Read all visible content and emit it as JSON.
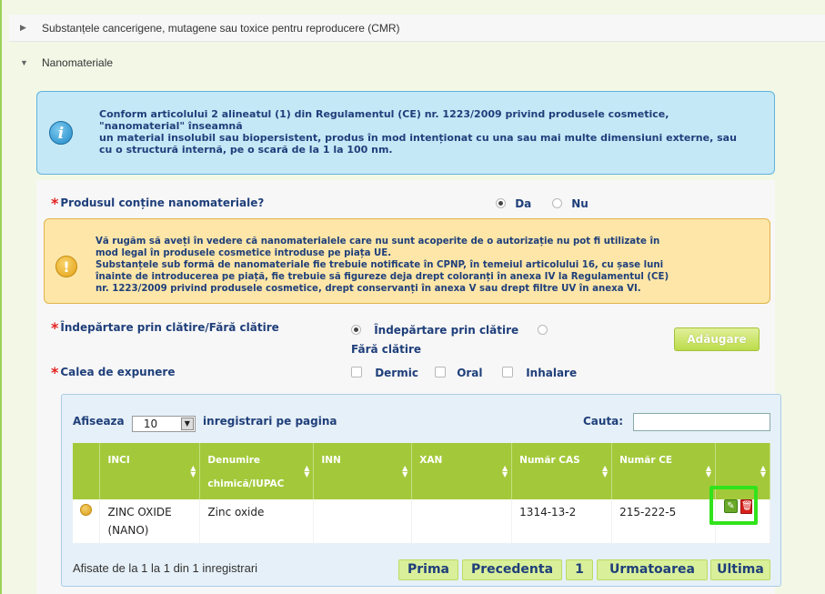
{
  "accordion": {
    "cmr_title": "Substanțele cancerigene, mutagene sau toxice pentru reproducere (CMR)",
    "nano_title": "Nanomateriale"
  },
  "info_box": {
    "line1": "Conform articolului 2 alineatul (1) din Regulamentul (CE) nr. 1223/2009 privind produsele cosmetice,",
    "line2": "\"nanomaterial\" înseamnă",
    "line3": "un material insolubil sau biopersistent, produs în mod intenționat cu una sau mai multe dimensiuni externe, sau",
    "line4": "cu o structură internă, pe o scară de la 1 la 100 nm.",
    "icon": "info-icon"
  },
  "contains_nano": {
    "label": "Produsul conține nanomateriale?",
    "option_yes": "Da",
    "option_no": "Nu",
    "selected": "Da"
  },
  "warning_box": {
    "line1": "Vă rugăm să aveți în vedere că nanomaterialele care nu sunt acoperite de o autorizație nu pot fi utilizate în",
    "line2": "mod legal în produsele cosmetice introduse pe piața UE.",
    "line3": "Substanțele sub formă de nanomateriale fie trebuie notificate în CPNP, în temeiul articolului 16, cu șase luni",
    "line4": "înainte de introducerea pe piață, fie trebuie să figureze deja drept coloranți în anexa IV la Regulamentul (CE)",
    "line5": "nr. 1223/2009 privind produsele cosmetice, drept conservanți în anexa V sau drept filtre UV în anexa VI.",
    "icon": "warning-icon"
  },
  "rinse": {
    "label": "Îndepărtare prin clătire/Fără clătire",
    "option_rinse": "Îndepărtare prin clătire",
    "option_leave": "Fără clătire",
    "selected": "Îndepărtare prin clătire"
  },
  "add_button": "Adăugare",
  "exposure": {
    "label": "Calea de expunere",
    "options": [
      "Dermic",
      "Oral",
      "Inhalare"
    ]
  },
  "table_controls": {
    "show_label": "Afiseaza",
    "page_size": "10",
    "per_page_label": "inregistrari pe pagina",
    "search_label": "Cauta:",
    "search_value": ""
  },
  "columns": {
    "inci": "INCI",
    "chem_line1": "Denumire",
    "chem_line2": "chimică/IUPAC",
    "inn": "INN",
    "xan": "XAN",
    "cas": "Număr CAS",
    "ce": "Număr CE"
  },
  "rows": [
    {
      "inci_line1": "ZINC OXIDE",
      "inci_line2": "(NANO)",
      "chem": "Zinc oxide",
      "inn": "",
      "xan": "",
      "cas": "1314-13-2",
      "ce": "215-222-5"
    }
  ],
  "footer": {
    "info": "Afisate de la 1 la 1 din 1 inregistrari",
    "first": "Prima",
    "prev": "Precedenta",
    "page": "1",
    "next": "Urmatoarea",
    "last": "Ultima"
  },
  "colors": {
    "accent_green": "#a3c93a",
    "highlight": "#31e31b",
    "info_bg": "#c5e8f7",
    "warning_bg": "#fde6a8",
    "label_blue": "#1f3f7a",
    "required_red": "#e4221f"
  }
}
